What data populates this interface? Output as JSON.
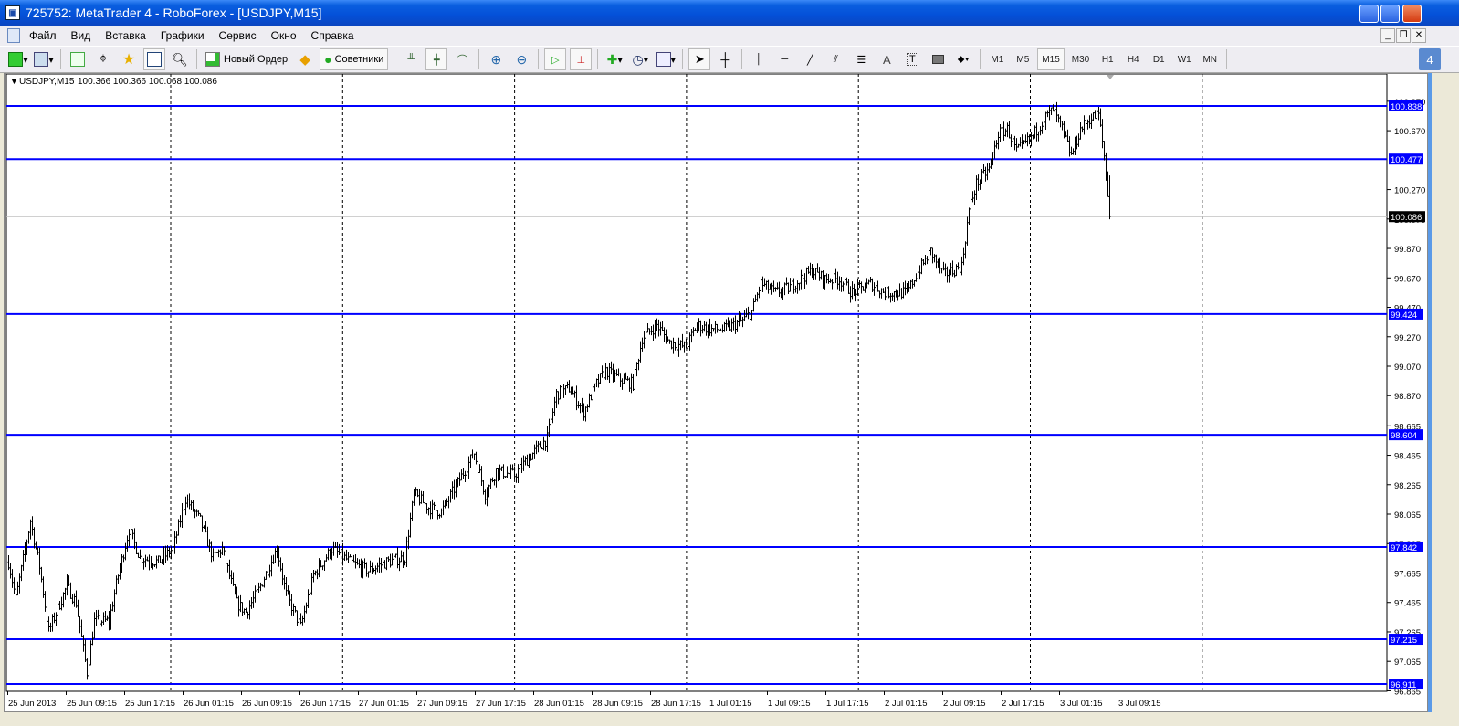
{
  "window": {
    "title": "725752: MetaTrader 4 - RoboForex - [USDJPY,M15]"
  },
  "menu": [
    "Файл",
    "Вид",
    "Вставка",
    "Графики",
    "Сервис",
    "Окно",
    "Справка"
  ],
  "toolbar": {
    "new_order": "Новый Ордер",
    "experts": "Советники",
    "timeframes": [
      "M1",
      "M5",
      "M15",
      "M30",
      "H1",
      "H4",
      "D1",
      "W1",
      "MN"
    ],
    "active_timeframe": "M15",
    "badge": "4",
    "draw_tool_letter": "A"
  },
  "chart_header": {
    "symbol": "USDJPY,M15",
    "ohlc": "100.366 100.366 100.068 100.086"
  },
  "chart_data": {
    "type": "ohlc",
    "symbol": "USDJPY",
    "timeframe": "M15",
    "ylim": [
      96.86,
      100.88
    ],
    "price_ticks": [
      "100.870",
      "100.670",
      "100.270",
      "100.070",
      "99.870",
      "99.670",
      "99.470",
      "99.270",
      "99.070",
      "98.870",
      "98.665",
      "98.465",
      "98.265",
      "98.065",
      "97.865",
      "97.665",
      "97.465",
      "97.265",
      "97.065",
      "96.865"
    ],
    "x_labels": [
      "25 Jun 2013",
      "25 Jun 09:15",
      "25 Jun 17:15",
      "26 Jun 01:15",
      "26 Jun 09:15",
      "26 Jun 17:15",
      "27 Jun 01:15",
      "27 Jun 09:15",
      "27 Jun 17:15",
      "28 Jun 01:15",
      "28 Jun 09:15",
      "28 Jun 17:15",
      "1 Jul 01:15",
      "1 Jul 09:15",
      "1 Jul 17:15",
      "2 Jul 01:15",
      "2 Jul 09:15",
      "2 Jul 17:15",
      "3 Jul 01:15",
      "3 Jul 09:15"
    ],
    "bars_per_label": 32,
    "horizontal_lines": [
      "100.838",
      "100.477",
      "99.424",
      "98.604",
      "97.842",
      "97.215",
      "96.911"
    ],
    "bid": "100.086",
    "line_color": "#0000ff",
    "close_anchors": [
      [
        0,
        97.74
      ],
      [
        4,
        97.49
      ],
      [
        12,
        98.02
      ],
      [
        17,
        97.71
      ],
      [
        22,
        97.27
      ],
      [
        32,
        97.58
      ],
      [
        37,
        97.46
      ],
      [
        43,
        96.99
      ],
      [
        47,
        97.34
      ],
      [
        55,
        97.34
      ],
      [
        60,
        97.65
      ],
      [
        66,
        97.96
      ],
      [
        72,
        97.77
      ],
      [
        82,
        97.74
      ],
      [
        90,
        97.83
      ],
      [
        97,
        98.17
      ],
      [
        105,
        98.02
      ],
      [
        112,
        97.77
      ],
      [
        117,
        97.83
      ],
      [
        125,
        97.46
      ],
      [
        130,
        97.4
      ],
      [
        137,
        97.55
      ],
      [
        147,
        97.83
      ],
      [
        152,
        97.52
      ],
      [
        160,
        97.3
      ],
      [
        167,
        97.65
      ],
      [
        177,
        97.83
      ],
      [
        187,
        97.74
      ],
      [
        197,
        97.68
      ],
      [
        207,
        97.74
      ],
      [
        217,
        97.77
      ],
      [
        222,
        98.2
      ],
      [
        230,
        98.11
      ],
      [
        237,
        98.08
      ],
      [
        247,
        98.3
      ],
      [
        255,
        98.48
      ],
      [
        261,
        98.2
      ],
      [
        267,
        98.36
      ],
      [
        277,
        98.33
      ],
      [
        285,
        98.45
      ],
      [
        295,
        98.58
      ],
      [
        300,
        98.88
      ],
      [
        307,
        98.92
      ],
      [
        315,
        98.76
      ],
      [
        322,
        98.95
      ],
      [
        327,
        99.04
      ],
      [
        335,
        98.98
      ],
      [
        342,
        98.95
      ],
      [
        347,
        99.26
      ],
      [
        355,
        99.35
      ],
      [
        362,
        99.23
      ],
      [
        371,
        99.2
      ],
      [
        377,
        99.35
      ],
      [
        385,
        99.32
      ],
      [
        392,
        99.32
      ],
      [
        402,
        99.38
      ],
      [
        407,
        99.44
      ],
      [
        412,
        99.63
      ],
      [
        420,
        99.57
      ],
      [
        427,
        99.6
      ],
      [
        440,
        99.72
      ],
      [
        447,
        99.66
      ],
      [
        455,
        99.66
      ],
      [
        462,
        99.57
      ],
      [
        472,
        99.63
      ],
      [
        480,
        99.57
      ],
      [
        492,
        99.57
      ],
      [
        497,
        99.69
      ],
      [
        505,
        99.85
      ],
      [
        512,
        99.69
      ],
      [
        522,
        99.75
      ],
      [
        526,
        100.13
      ],
      [
        530,
        100.31
      ],
      [
        537,
        100.41
      ],
      [
        542,
        100.65
      ],
      [
        547,
        100.68
      ],
      [
        552,
        100.53
      ],
      [
        560,
        100.62
      ],
      [
        567,
        100.75
      ],
      [
        572,
        100.81
      ],
      [
        577,
        100.68
      ],
      [
        582,
        100.5
      ],
      [
        587,
        100.68
      ],
      [
        592,
        100.75
      ],
      [
        597,
        100.78
      ],
      [
        600,
        100.5
      ],
      [
        603,
        100.086
      ]
    ]
  }
}
